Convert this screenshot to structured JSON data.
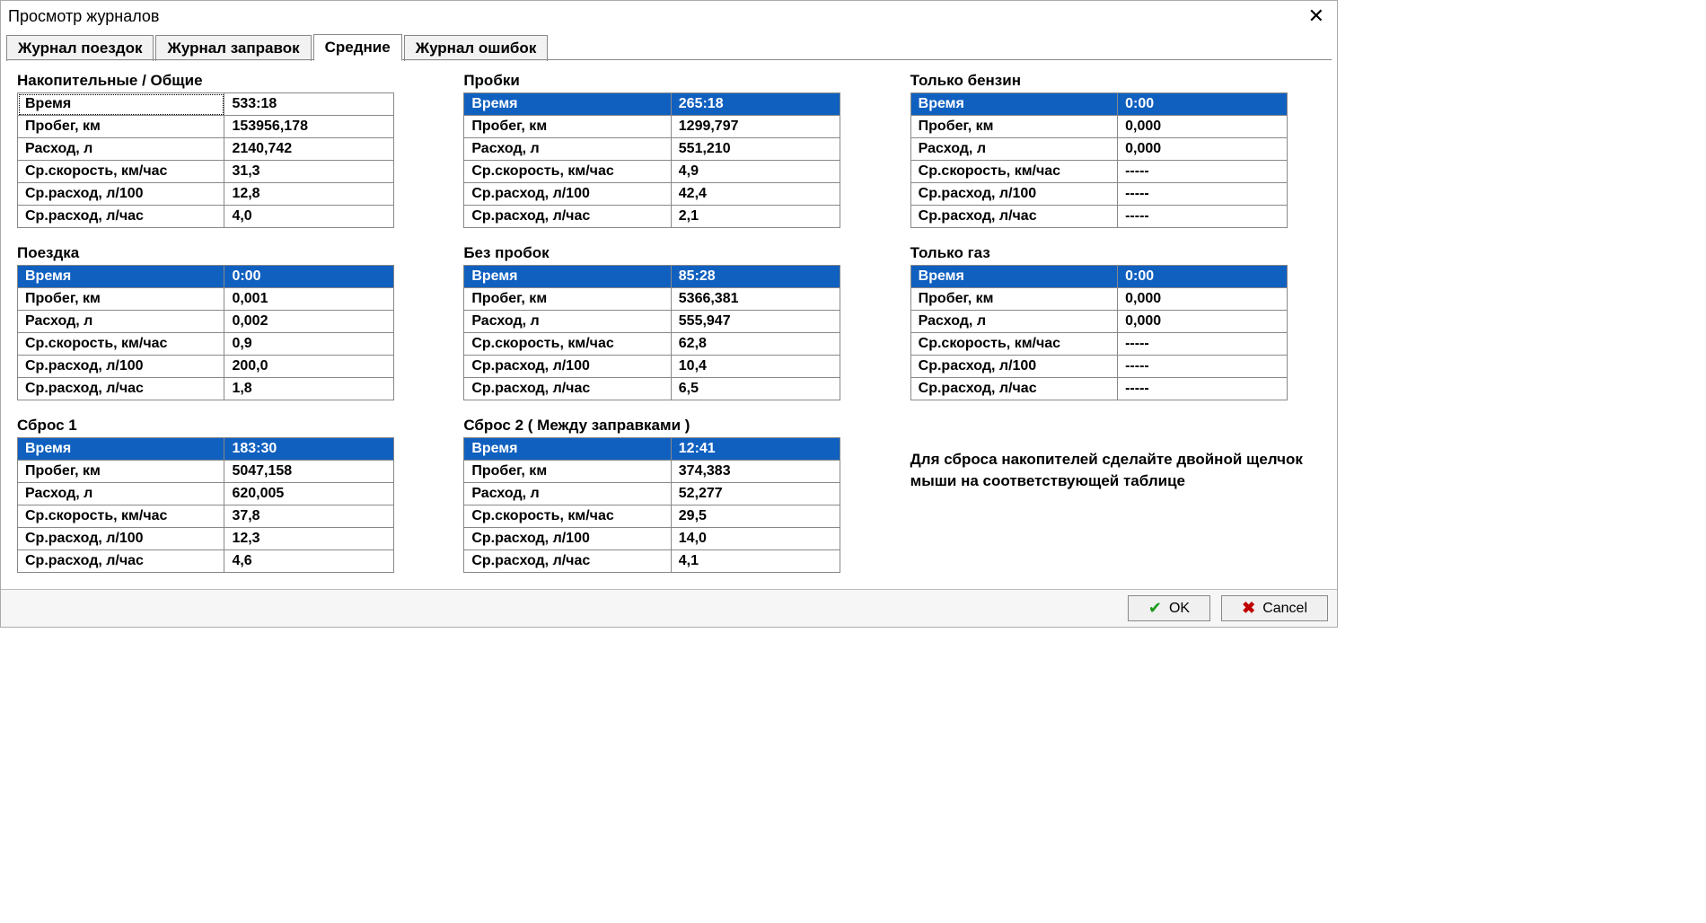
{
  "title": "Просмотр журналов",
  "tabs": [
    "Журнал поездок",
    "Журнал заправок",
    "Средние",
    "Журнал ошибок"
  ],
  "active_tab": 2,
  "row_labels": [
    "Время",
    "Пробег, км",
    "Расход, л",
    "Ср.скорость, км/час",
    "Ср.расход, л/100",
    "Ср.расход, л/час"
  ],
  "blocks": {
    "cumulative": {
      "title": "Накопительные / Общие",
      "highlight": false,
      "selected": true,
      "values": [
        "533:18",
        "153956,178",
        "2140,742",
        "31,3",
        "12,8",
        "4,0"
      ]
    },
    "traffic": {
      "title": "Пробки",
      "highlight": true,
      "values": [
        "265:18",
        "1299,797",
        "551,210",
        "4,9",
        "42,4",
        "2,1"
      ]
    },
    "petrol_only": {
      "title": "Только бензин",
      "highlight": true,
      "values": [
        "0:00",
        "0,000",
        "0,000",
        "-----",
        "-----",
        "-----"
      ]
    },
    "trip": {
      "title": "Поездка",
      "highlight": true,
      "values": [
        "0:00",
        "0,001",
        "0,002",
        "0,9",
        "200,0",
        "1,8"
      ]
    },
    "no_traffic": {
      "title": "Без пробок",
      "highlight": true,
      "values": [
        "85:28",
        "5366,381",
        "555,947",
        "62,8",
        "10,4",
        "6,5"
      ]
    },
    "gas_only": {
      "title": "Только газ",
      "highlight": true,
      "values": [
        "0:00",
        "0,000",
        "0,000",
        "-----",
        "-----",
        "-----"
      ]
    },
    "reset1": {
      "title": "Сброс 1",
      "highlight": true,
      "values": [
        "183:30",
        "5047,158",
        "620,005",
        "37,8",
        "12,3",
        "4,6"
      ]
    },
    "reset2": {
      "title": "Сброс 2 ( Между заправками )",
      "highlight": true,
      "values": [
        "12:41",
        "374,383",
        "52,277",
        "29,5",
        "14,0",
        "4,1"
      ]
    }
  },
  "hint": "Для сброса накопителей сделайте двойной щелчок мыши на соответствующей таблице",
  "buttons": {
    "ok": "OK",
    "cancel": "Cancel"
  }
}
